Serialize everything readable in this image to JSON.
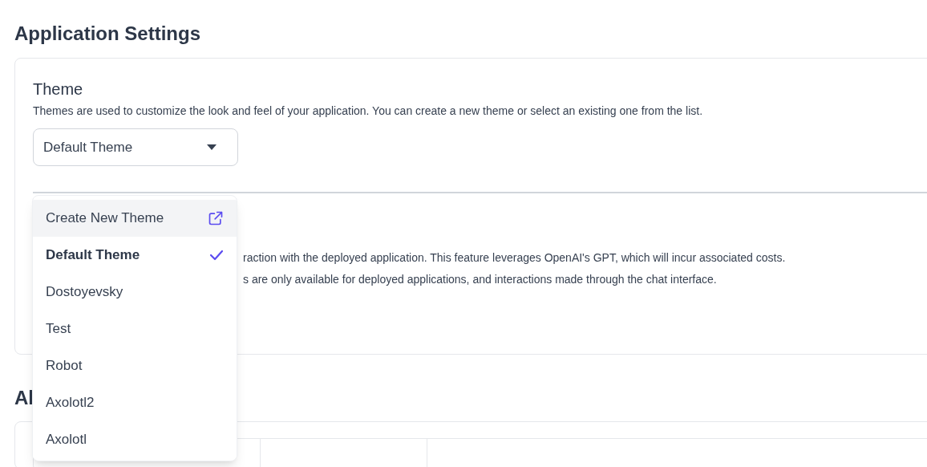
{
  "page_title": "Application Settings",
  "theme_section": {
    "title": "Theme",
    "description": "Themes are used to customize the look and feel of your application. You can create a new theme or select an existing one from the list.",
    "select": {
      "value": "Default Theme",
      "expanded": true
    }
  },
  "second_section": {
    "description_lines": [
      "raction with the deployed application. This feature leverages OpenAI's GPT, which will incur associated costs.",
      "s are only available for deployed applications, and interactions made through the chat interface."
    ]
  },
  "second_heading": "Al",
  "dropdown": {
    "items": [
      {
        "label": "Create New Theme",
        "kind": "action",
        "selected": false,
        "highlighted": true
      },
      {
        "label": "Default Theme",
        "kind": "option",
        "selected": true,
        "highlighted": false
      },
      {
        "label": "Dostoyevsky",
        "kind": "option",
        "selected": false,
        "highlighted": false
      },
      {
        "label": "Test",
        "kind": "option",
        "selected": false,
        "highlighted": false
      },
      {
        "label": "Robot",
        "kind": "option",
        "selected": false,
        "highlighted": false
      },
      {
        "label": "Axolotl2",
        "kind": "option",
        "selected": false,
        "highlighted": false
      },
      {
        "label": "Axolotl",
        "kind": "option",
        "selected": false,
        "highlighted": false
      }
    ]
  }
}
